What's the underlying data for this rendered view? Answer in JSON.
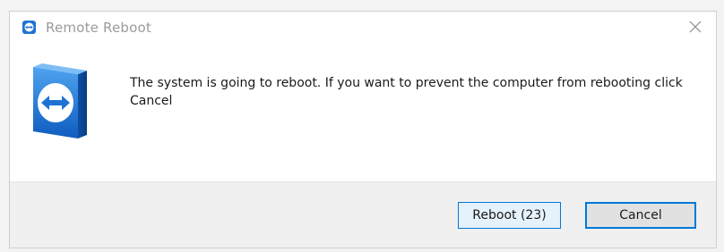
{
  "window": {
    "title": "Remote Reboot",
    "title_icon": "teamviewer-icon",
    "close_icon": "close-icon"
  },
  "content": {
    "app_icon": "teamviewer-logo-icon",
    "message": "The system is going to reboot. If you want to prevent the computer from rebooting click Cancel"
  },
  "buttons": {
    "reboot_label": "Reboot (23)",
    "cancel_label": "Cancel"
  },
  "colors": {
    "accent": "#0078d7",
    "teamviewer_blue": "#1e73d2"
  }
}
